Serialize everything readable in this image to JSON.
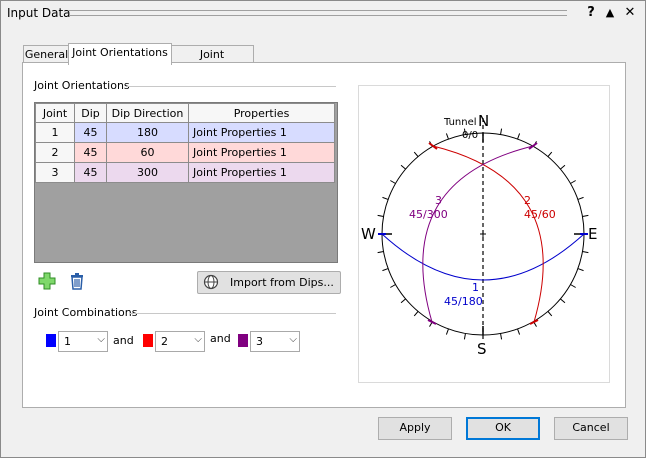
{
  "window": {
    "title": "Input Data",
    "help_glyph": "?",
    "collapse_glyph": "▲",
    "close_glyph": "✕"
  },
  "tabs": [
    {
      "label": "General"
    },
    {
      "label": "Joint Orientations",
      "active": true
    },
    {
      "label": "Joint Properties"
    }
  ],
  "joint_orientations": {
    "group_label": "Joint Orientations",
    "columns": [
      "Joint",
      "Dip",
      "Dip Direction",
      "Properties"
    ],
    "rows": [
      {
        "joint": "1",
        "dip": "45",
        "dip_direction": "180",
        "properties": "Joint Properties 1",
        "row_color": "#d7dcff"
      },
      {
        "joint": "2",
        "dip": "45",
        "dip_direction": "60",
        "properties": "Joint Properties 1",
        "row_color": "#ffd9d9"
      },
      {
        "joint": "3",
        "dip": "45",
        "dip_direction": "300",
        "properties": "Joint Properties 1",
        "row_color": "#ecd9ee"
      }
    ]
  },
  "toolbar": {
    "add_icon": "plus-icon",
    "delete_icon": "trash-icon",
    "import_label": "Import from Dips...",
    "import_icon": "globe-icon"
  },
  "joint_combinations": {
    "group_label": "Joint Combinations",
    "and_label": "and",
    "combos": [
      {
        "value": "1",
        "color": "#0000ff"
      },
      {
        "value": "2",
        "color": "#ff0000"
      },
      {
        "value": "3",
        "color": "#800080"
      }
    ]
  },
  "stereonet": {
    "directions": {
      "north": "N",
      "south": "S",
      "east": "E",
      "west": "W"
    },
    "tunnel_label": "Tunnel",
    "tunnel_orientation": "0/0",
    "planes": [
      {
        "id": "1",
        "label": "45/180",
        "color": "#0000cc"
      },
      {
        "id": "2",
        "label": "45/60",
        "color": "#cc0000"
      },
      {
        "id": "3",
        "label": "45/300",
        "color": "#800080"
      }
    ]
  },
  "buttons": {
    "apply": "Apply",
    "ok": "OK",
    "cancel": "Cancel"
  }
}
